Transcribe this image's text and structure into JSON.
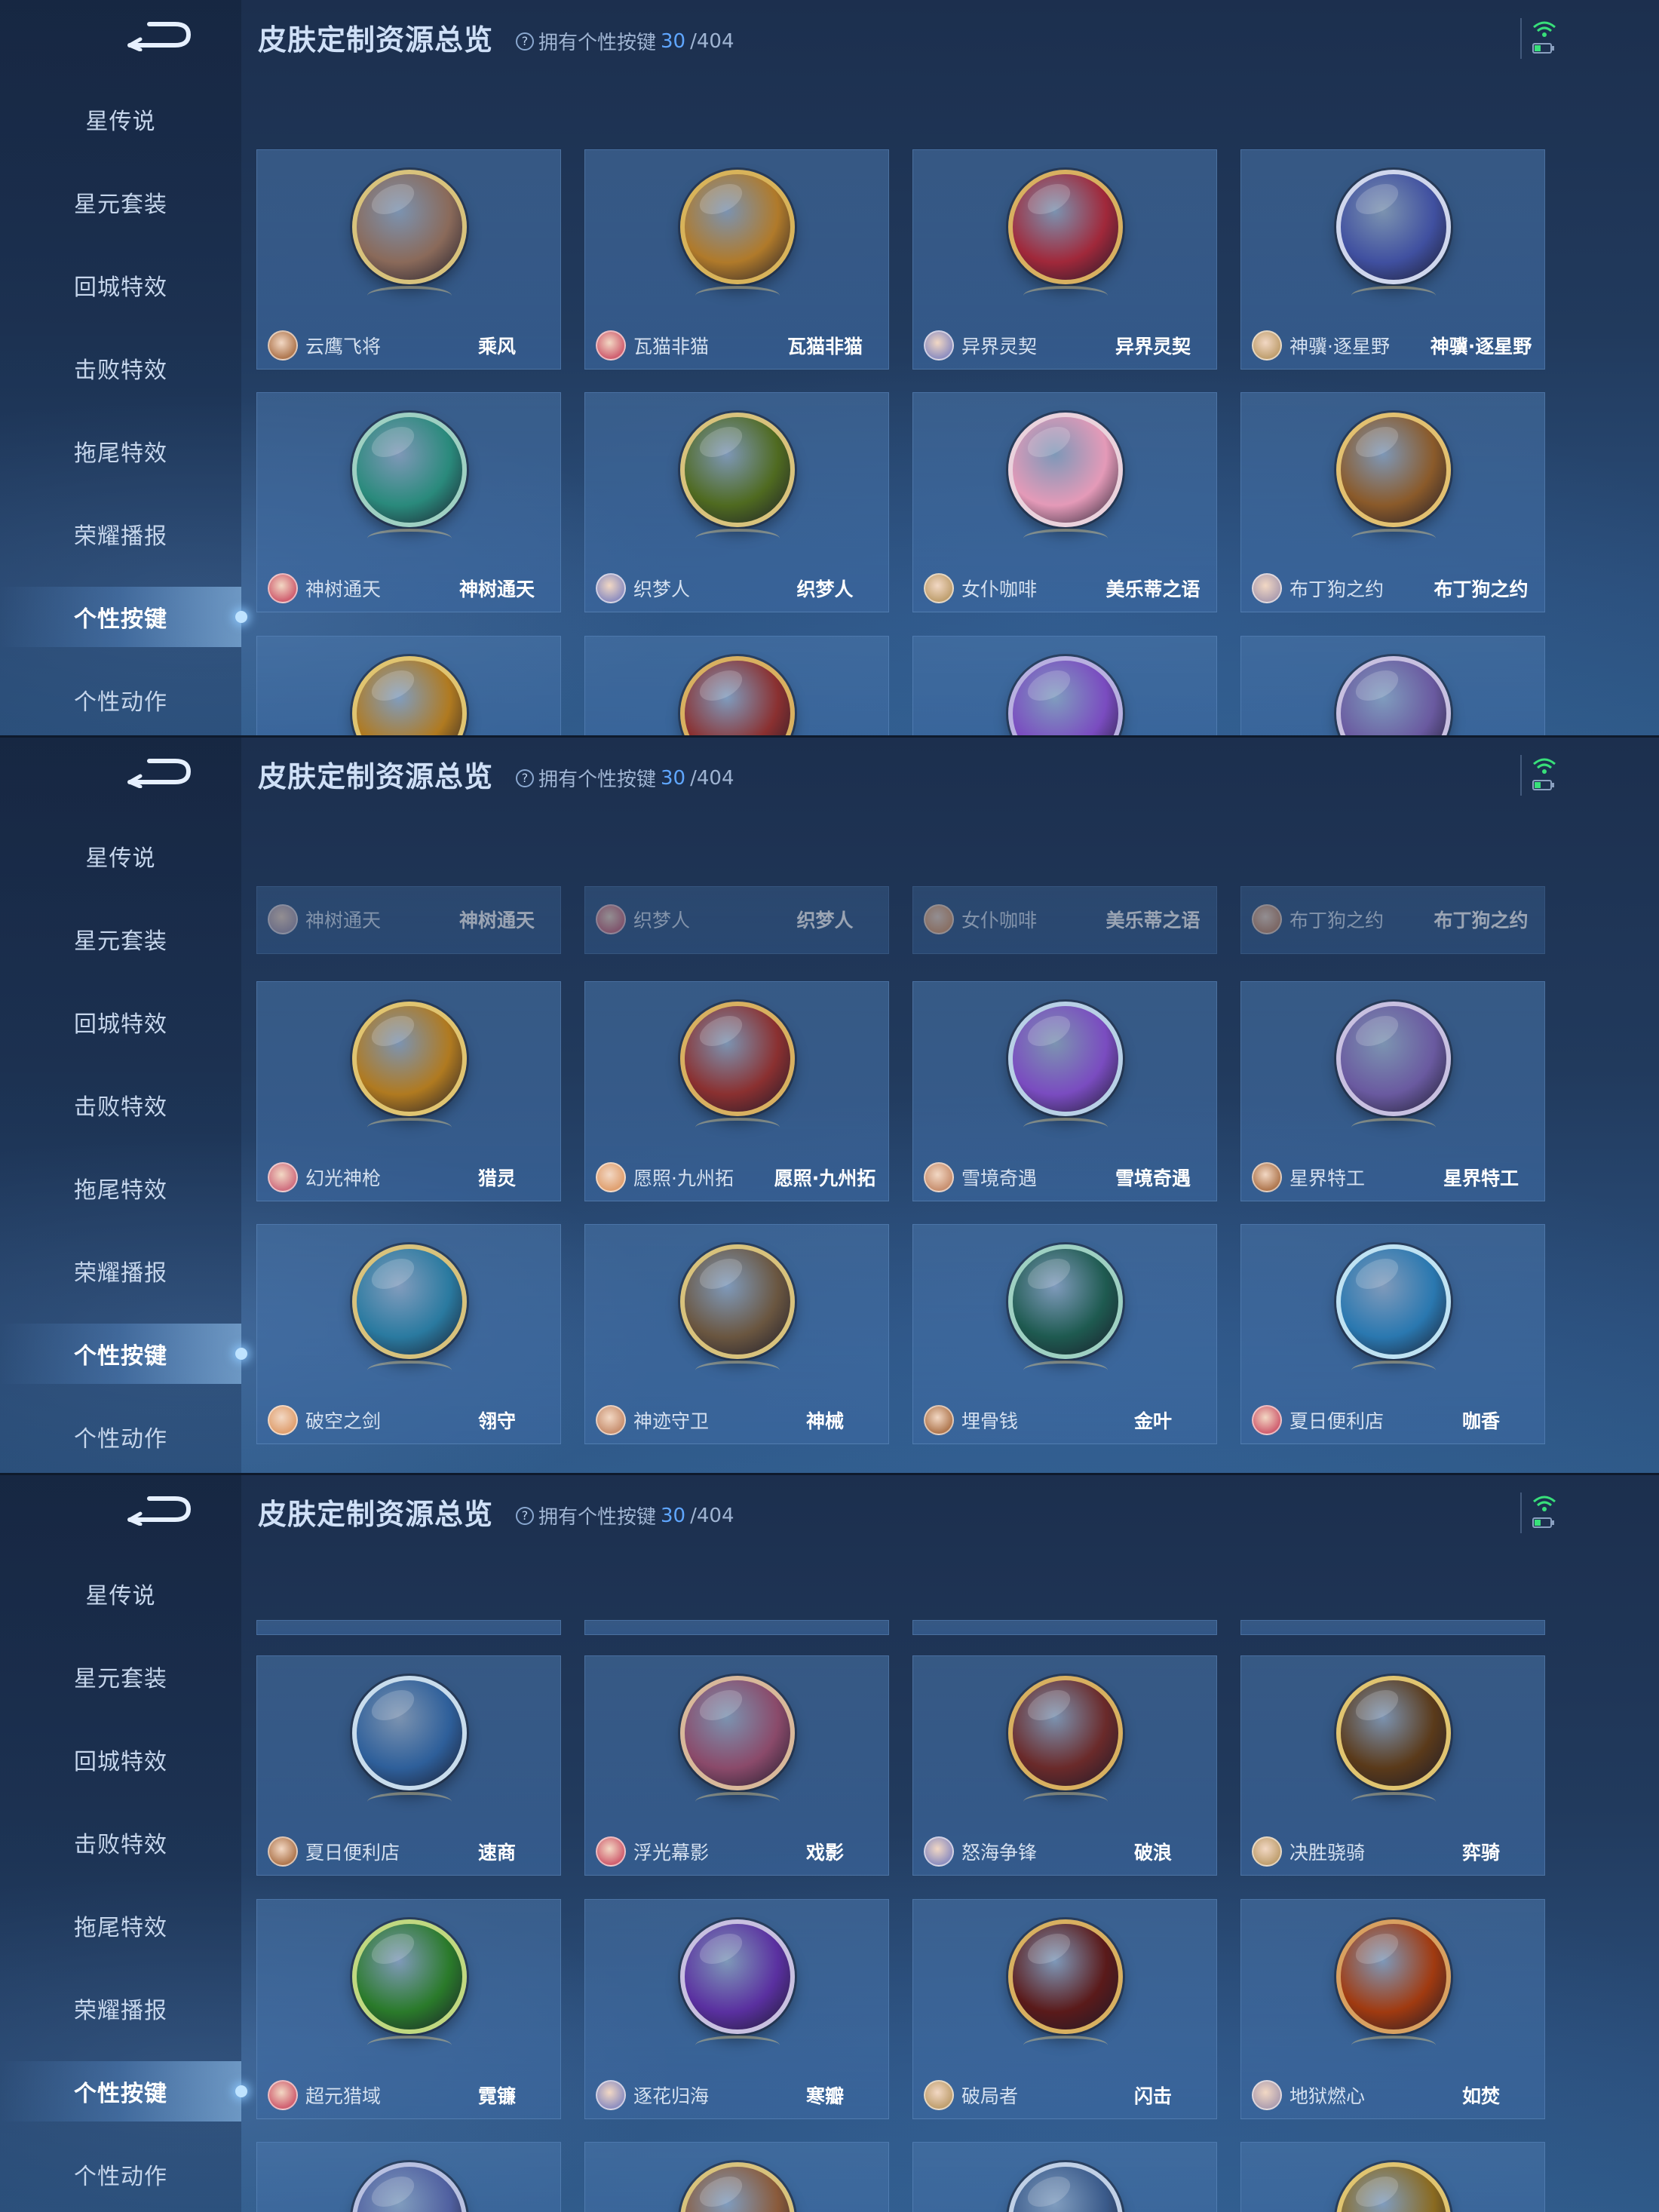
{
  "header": {
    "title": "皮肤定制资源总览",
    "owned_prefix": "拥有个性按键",
    "owned_count": "30",
    "owned_total": "/404",
    "help_icon": "question-icon"
  },
  "sidebar": {
    "back_icon": "back-arrow-icon",
    "items": [
      {
        "label": "星传说"
      },
      {
        "label": "星元套装"
      },
      {
        "label": "回城特效"
      },
      {
        "label": "击败特效"
      },
      {
        "label": "拖尾特效"
      },
      {
        "label": "荣耀播报"
      },
      {
        "label": "个性按键",
        "active": true
      },
      {
        "label": "个性动作"
      }
    ]
  },
  "status_icons": [
    "wifi-icon",
    "battery-icon"
  ],
  "screens": [
    {
      "rows": [
        [
          {
            "hero": "云鹰飞将",
            "skin": "乘风",
            "ring": "#d8c27c",
            "fill": "#8a6a5a"
          },
          {
            "hero": "瓦猫非猫",
            "skin": "瓦猫非猫",
            "ring": "#d8b35a",
            "fill": "#b07a2a"
          },
          {
            "hero": "异界灵契",
            "skin": "异界灵契",
            "ring": "#d8b060",
            "fill": "#a0283a"
          },
          {
            "hero": "神骥·逐星野",
            "skin": "神骥·逐星野",
            "ring": "#cfd6ec",
            "fill": "#4050a0"
          }
        ],
        [
          {
            "hero": "神树通天",
            "skin": "神树通天",
            "ring": "#9ed0c2",
            "fill": "#2a8a7c"
          },
          {
            "hero": "织梦人",
            "skin": "织梦人",
            "ring": "#d8c27c",
            "fill": "#4f6a20"
          },
          {
            "hero": "女仆咖啡",
            "skin": "美乐蒂之语",
            "ring": "#ead2dc",
            "fill": "#e49ab8"
          },
          {
            "hero": "布丁狗之约",
            "skin": "布丁狗之约",
            "ring": "#e2c070",
            "fill": "#8a5a2a"
          }
        ],
        [
          {
            "ring": "#e0c470",
            "fill": "#b07a20"
          },
          {
            "ring": "#d8b060",
            "fill": "#8a3030"
          },
          {
            "ring": "#b8b0e0",
            "fill": "#7a4cc0"
          },
          {
            "ring": "#c8c0e0",
            "fill": "#6a5aa0"
          }
        ]
      ]
    },
    {
      "rows": [
        [
          {
            "hero": "神树通天",
            "skin": "神树通天"
          },
          {
            "hero": "织梦人",
            "skin": "织梦人"
          },
          {
            "hero": "女仆咖啡",
            "skin": "美乐蒂之语"
          },
          {
            "hero": "布丁狗之约",
            "skin": "布丁狗之约"
          }
        ],
        [
          {
            "hero": "幻光神枪",
            "skin": "猎灵",
            "ring": "#e0c470",
            "fill": "#b07a20"
          },
          {
            "hero": "愿照·九州拓",
            "skin": "愿照·九州拓",
            "ring": "#d8b060",
            "fill": "#8a3030"
          },
          {
            "hero": "雪境奇遇",
            "skin": "雪境奇遇",
            "ring": "#b8d0e6",
            "fill": "#7a4cc0"
          },
          {
            "hero": "星界特工",
            "skin": "星界特工",
            "ring": "#c8c0e0",
            "fill": "#6a5aa0"
          }
        ],
        [
          {
            "hero": "破空之剑",
            "skin": "翎守",
            "ring": "#d8c27c",
            "fill": "#2a7aa0"
          },
          {
            "hero": "神迹守卫",
            "skin": "神械",
            "ring": "#d8c27c",
            "fill": "#6a5640"
          },
          {
            "hero": "埋骨钱",
            "skin": "金叶",
            "ring": "#9ed0c2",
            "fill": "#1e5a50"
          },
          {
            "hero": "夏日便利店",
            "skin": "咖香",
            "ring": "#bfe2f2",
            "fill": "#2a78b0"
          }
        ]
      ]
    },
    {
      "rows": [
        [
          {
            "hero": "夏日便利店",
            "skin": "速商",
            "ring": "#c8dcec",
            "fill": "#2e5f9a"
          },
          {
            "hero": "浮光幕影",
            "skin": "戏影",
            "ring": "#d8b89a",
            "fill": "#8a4a6a"
          },
          {
            "hero": "怒海争锋",
            "skin": "破浪",
            "ring": "#d8b060",
            "fill": "#6a2a2a"
          },
          {
            "hero": "决胜骁骑",
            "skin": "弈骑",
            "ring": "#e0c470",
            "fill": "#5a3a1a"
          }
        ],
        [
          {
            "hero": "超元猎域",
            "skin": "霓镰",
            "ring": "#c0d880",
            "fill": "#2a7a2a"
          },
          {
            "hero": "逐花归海",
            "skin": "寒瓣",
            "ring": "#c8c0e0",
            "fill": "#5a30a0"
          },
          {
            "hero": "破局者",
            "skin": "闪击",
            "ring": "#d8b060",
            "fill": "#5a1a1a"
          },
          {
            "hero": "地狱燃心",
            "skin": "如焚",
            "ring": "#d8a060",
            "fill": "#a03a10"
          }
        ],
        [
          {
            "ring": "#b8c0e0",
            "fill": "#5060a0"
          },
          {
            "ring": "#d8c27c",
            "fill": "#8a5a3a"
          },
          {
            "ring": "#c0d0e6",
            "fill": "#3a5a8a"
          },
          {
            "ring": "#e0c470",
            "fill": "#8a6a20"
          }
        ]
      ]
    }
  ]
}
